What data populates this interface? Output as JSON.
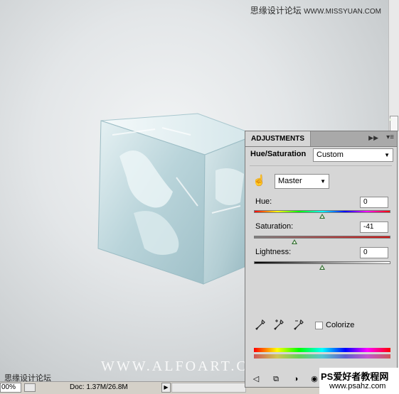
{
  "watermarks": {
    "top_cn": "思缘设计论坛",
    "top_url": "WWW.MISSYUAN.COM",
    "bottom_cn": "思缘设计论坛",
    "alfoart": "WWW.ALFOART.CO",
    "psahz_line1": "PS爱好者教程网",
    "psahz_line2": "www.psahz.com"
  },
  "status_bar": {
    "zoom": "00%",
    "doc": "Doc: 1.37M/26.8M"
  },
  "panel": {
    "tab": "ADJUSTMENTS",
    "collapse_icon": "double-arrow-icon",
    "menu_icon": "panel-menu-icon",
    "heading": "Hue/Saturation",
    "preset": "Custom",
    "channel": "Master",
    "hue": {
      "label": "Hue:",
      "value": "0",
      "slider_fraction": 0.5
    },
    "saturation": {
      "label": "Saturation:",
      "value": "-41",
      "slider_fraction": 0.295
    },
    "lightness": {
      "label": "Lightness:",
      "value": "0",
      "slider_fraction": 0.5
    },
    "colorize": {
      "label": "Colorize",
      "checked": false
    },
    "eyedroppers": [
      "eyedropper-icon",
      "eyedropper-plus-icon",
      "eyedropper-minus-icon"
    ],
    "toolbar_icons": [
      "back-arrow-icon",
      "clip-to-layer-icon",
      "visibility-circle-icon",
      "eye-icon"
    ]
  }
}
